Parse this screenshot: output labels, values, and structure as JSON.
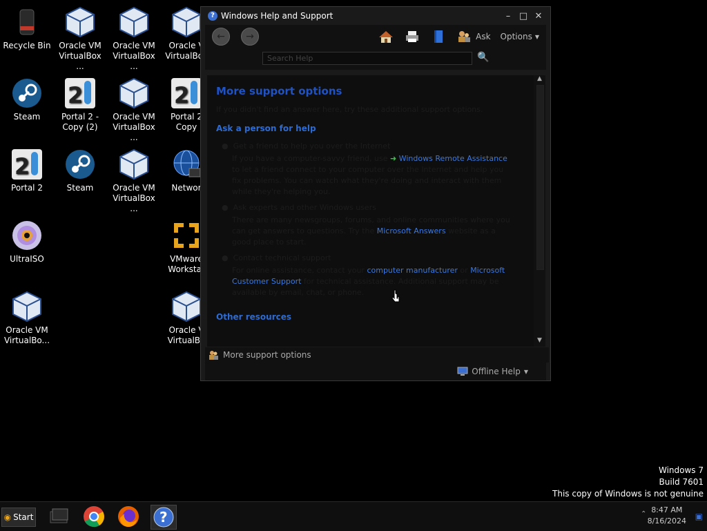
{
  "desktop": {
    "icons": [
      {
        "label": "Recycle Bin",
        "icon": "recycle-bin-icon"
      },
      {
        "label": "Oracle VM\nVirtualBox ...",
        "icon": "virtualbox-icon"
      },
      {
        "label": "Oracle VM\nVirtualBox ...",
        "icon": "virtualbox-icon"
      },
      {
        "label": "Oracle V\nVirtualBox",
        "icon": "virtualbox-icon"
      },
      {
        "label": "Steam",
        "icon": "steam-icon"
      },
      {
        "label": "Portal 2 -\nCopy (2)",
        "icon": "portal2-icon"
      },
      {
        "label": "Oracle VM\nVirtualBox ...",
        "icon": "virtualbox-icon"
      },
      {
        "label": "Portal 2\nCopy",
        "icon": "portal2-icon"
      },
      {
        "label": "Portal 2",
        "icon": "portal2-icon"
      },
      {
        "label": "Steam",
        "icon": "steam-icon"
      },
      {
        "label": "Oracle VM\nVirtualBox ...",
        "icon": "virtualbox-icon"
      },
      {
        "label": "Networ",
        "icon": "network-icon"
      },
      {
        "label": "UltraISO",
        "icon": "ultraiso-icon"
      },
      {
        "label": "VMware\nWorkstat",
        "icon": "vmware-icon"
      },
      {
        "label": "Oracle VM\nVirtualBo...",
        "icon": "virtualbox-icon"
      },
      {
        "label": "Oracle V\nVirtualBo",
        "icon": "virtualbox-icon"
      }
    ]
  },
  "window": {
    "title": "Windows Help and Support",
    "toolbar": {
      "ask_label": "Ask",
      "options_label": "Options"
    },
    "search": {
      "placeholder": "Search Help"
    },
    "content": {
      "heading": "More support options",
      "intro": "If you didn't find an answer here, try these additional support options.",
      "section1": "Ask a person for help",
      "bullet1": "Get a friend to help you over the Internet",
      "para1_a": "If you have a computer-savvy friend, use",
      "link_remote": "Windows Remote Assistance",
      "para1_b": "to let a friend connect to your computer over the Internet and help you fix problems. You can watch what they're doing and interact with them while they're helping you.",
      "bullet2": "Ask experts and other Windows users",
      "para2_a": "There are many newsgroups, forums, and online communities where you can get answers to questions. Try the",
      "link_answers": "Microsoft Answers",
      "para2_b": "website as a good place to start.",
      "bullet3": "Contact technical support",
      "para3_a": "For online assistance, contact your",
      "link_manufacturer": "computer manufacturer",
      "para3_b": "or",
      "link_support": "Microsoft Customer Support",
      "para3_c": "for technical assistance. Additional support may be available by email, chat, or phone.",
      "section2": "Other resources"
    },
    "bottom_label": "More support options",
    "offline_label": "Offline Help"
  },
  "taskbar": {
    "start_label": "Start",
    "clock_time": "8:47 AM",
    "clock_date": "8/16/2024"
  },
  "watermark": {
    "line1": "Windows 7",
    "line2": "Build 7601",
    "line3": "This copy of Windows is not genuine"
  },
  "colors": {
    "link": "#3a78e0",
    "heading": "#1f52c5"
  }
}
